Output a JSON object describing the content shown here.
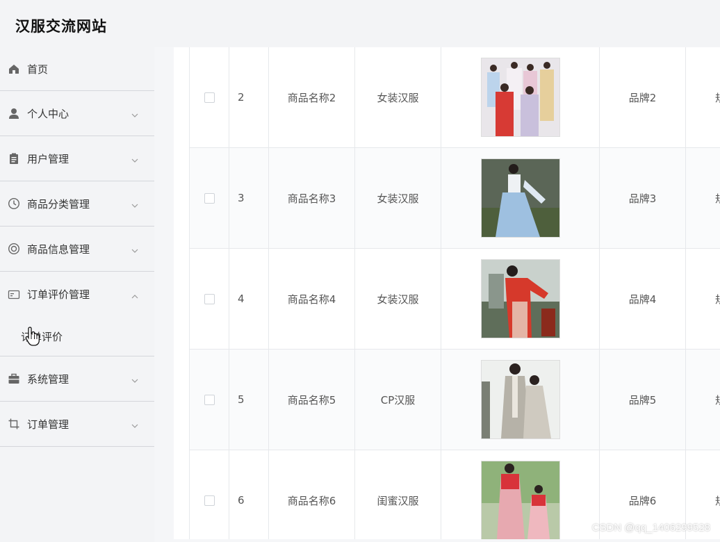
{
  "app": {
    "title": "汉服交流网站"
  },
  "sidebar": {
    "items": [
      {
        "label": "首页",
        "icon": "home-icon",
        "expandable": false
      },
      {
        "label": "个人中心",
        "icon": "user-icon",
        "expandable": true
      },
      {
        "label": "用户管理",
        "icon": "clipboard-icon",
        "expandable": true
      },
      {
        "label": "商品分类管理",
        "icon": "clock-icon",
        "expandable": true
      },
      {
        "label": "商品信息管理",
        "icon": "lifebuoy-icon",
        "expandable": true
      },
      {
        "label": "订单评价管理",
        "icon": "card-icon",
        "expandable": true,
        "expanded": true,
        "children": [
          {
            "label": "订单评价"
          }
        ]
      },
      {
        "label": "系统管理",
        "icon": "briefcase-icon",
        "expandable": true
      },
      {
        "label": "订单管理",
        "icon": "crop-icon",
        "expandable": true
      }
    ]
  },
  "table": {
    "rows": [
      {
        "index": "2",
        "name": "商品名称2",
        "category": "女装汉服",
        "image": "product-photo-group-of-women",
        "brand": "品牌2",
        "spec": "规"
      },
      {
        "index": "3",
        "name": "商品名称3",
        "category": "女装汉服",
        "image": "product-photo-woman-blue-dress",
        "brand": "品牌3",
        "spec": "规"
      },
      {
        "index": "4",
        "name": "商品名称4",
        "category": "女装汉服",
        "image": "product-photo-woman-red-dress",
        "brand": "品牌4",
        "spec": "规"
      },
      {
        "index": "5",
        "name": "商品名称5",
        "category": "CP汉服",
        "image": "product-photo-couple",
        "brand": "品牌5",
        "spec": "规"
      },
      {
        "index": "6",
        "name": "商品名称6",
        "category": "闺蜜汉服",
        "image": "product-photo-two-girls",
        "brand": "品牌6",
        "spec": "规"
      }
    ]
  },
  "watermark": "CSDN @qq_1406299528",
  "colors": {
    "sidebar_bg": "#f3f4f6",
    "divider": "#d4d6db",
    "table_border": "#e6e8eb",
    "text": "#333333"
  }
}
